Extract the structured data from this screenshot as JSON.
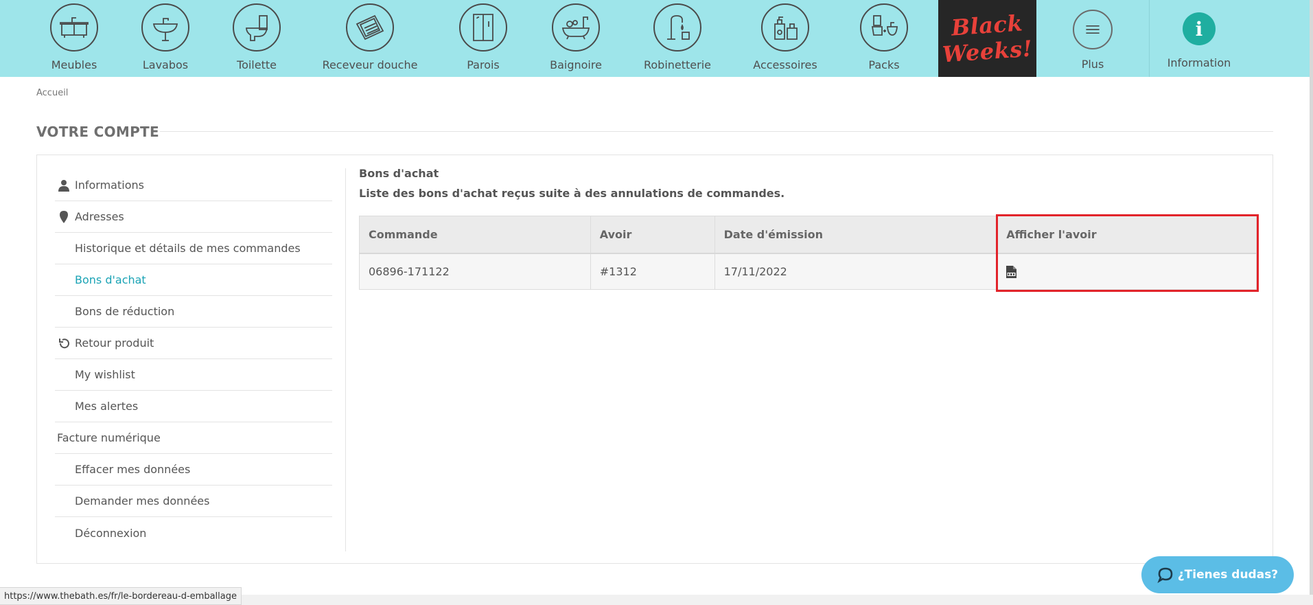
{
  "nav": {
    "items": [
      {
        "label": "Meubles",
        "icon": "vanity-unit-icon"
      },
      {
        "label": "Lavabos",
        "icon": "washbasin-icon"
      },
      {
        "label": "Toilette",
        "icon": "toilet-icon"
      },
      {
        "label": "Receveur douche",
        "icon": "shower-tray-icon"
      },
      {
        "label": "Parois",
        "icon": "shower-enclosure-icon"
      },
      {
        "label": "Baignoire",
        "icon": "bathtub-icon"
      },
      {
        "label": "Robinetterie",
        "icon": "faucet-icon"
      },
      {
        "label": "Accessoires",
        "icon": "soap-dispenser-icon"
      },
      {
        "label": "Packs",
        "icon": "toilet-pack-icon"
      }
    ],
    "black_weeks": {
      "line1": "Black",
      "line2": "Weeks!"
    },
    "more": {
      "label": "Plus",
      "icon": "list-icon"
    },
    "info": {
      "label": "Information",
      "icon": "info-icon",
      "glyph": "i"
    }
  },
  "breadcrumb": "Accueil",
  "page_title": "VOTRE COMPTE",
  "sidebar": {
    "items": [
      {
        "label": "Informations",
        "icon": "user-icon"
      },
      {
        "label": "Adresses",
        "icon": "map-pin-icon"
      },
      {
        "label": "Historique et détails de mes commandes"
      },
      {
        "label": "Bons d'achat",
        "active": true
      },
      {
        "label": "Bons de réduction"
      },
      {
        "label": "Retour produit",
        "icon": "undo-icon"
      },
      {
        "label": "My wishlist"
      },
      {
        "label": "Mes alertes"
      },
      {
        "label": "Facture numérique"
      },
      {
        "label": "Effacer mes données"
      },
      {
        "label": "Demander mes données"
      },
      {
        "label": "Déconnexion"
      }
    ]
  },
  "content": {
    "title": "Bons d'achat",
    "description": "Liste des bons d'achat reçus suite à des annulations de commandes.",
    "table": {
      "columns": [
        "Commande",
        "Avoir",
        "Date d'émission",
        "Afficher l'avoir"
      ],
      "rows": [
        {
          "commande": "06896-171122",
          "avoir": "#1312",
          "date": "17/11/2022",
          "view_icon": "pdf-icon"
        }
      ]
    }
  },
  "status_url": "https://www.thebath.es/fr/le-bordereau-d-emballage",
  "chat": {
    "label": "¿Tienes dudas?",
    "icon": "chat-bubble-icon"
  },
  "colors": {
    "nav_bg": "#9ee5ea",
    "black_weeks_bg": "#262626",
    "black_weeks_text": "#e8413a",
    "info_icon": "#1faea0",
    "active_link": "#1aa3b5",
    "highlight_border": "#e2232a",
    "chat_bg": "#5bbde6"
  }
}
